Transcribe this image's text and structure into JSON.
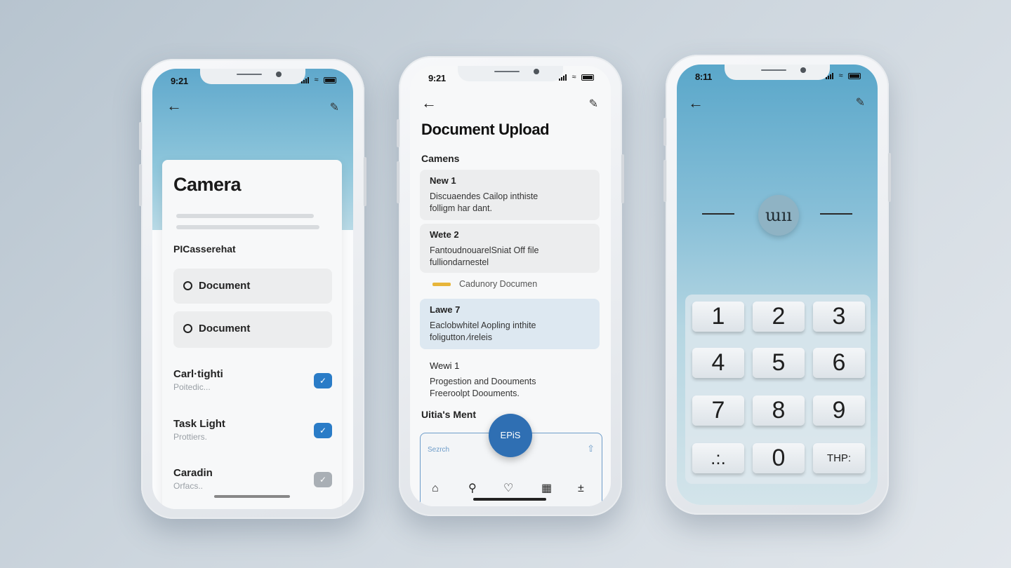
{
  "phones": {
    "camera": {
      "status_time": "9:21",
      "title": "Camera",
      "section": "PICasserehat",
      "options": [
        {
          "label": "Document"
        },
        {
          "label": "Document"
        }
      ],
      "toggles": [
        {
          "title": "Carl·tighti",
          "subtitle": "Poitedic...",
          "checked": true
        },
        {
          "title": "Task Light",
          "subtitle": "Prottiers.",
          "checked": true
        },
        {
          "title": "Caradin",
          "subtitle": "Orfacs..",
          "checked": false
        }
      ],
      "colors": {
        "accent": "#2a7cc7",
        "muted_check": "#a9afb5"
      }
    },
    "upload": {
      "status_time": "9:21",
      "title": "Document Upload",
      "section": "Camens",
      "cards": [
        {
          "title": "New 1",
          "line1": "Dis​cuaendes Cailop inthiste",
          "line2": "folligm har dant."
        },
        {
          "title": "Wete 2",
          "line1": "FantoudnouarelSniat Off file",
          "line2": "fulliondarnestel"
        }
      ],
      "legend_label": "Cadunory Documen",
      "highlight_card": {
        "title": "Lawe 7",
        "line1": "Eaclobwhitel Aopling inthite",
        "line2": "foligutton ∕ireleis"
      },
      "plain_card": {
        "title": "Wewi 1",
        "line1": "Progestion and Doouments",
        "line2": "Freeroolpt Doouments."
      },
      "footer_title": "Uitia's Ment",
      "search_label": "Sezrch",
      "fab_label": "EPiS",
      "colors": {
        "accent": "#2f6fb3",
        "legend": "#e7b53a",
        "highlight": "#dde8f1"
      }
    },
    "keypad": {
      "status_time": "8:11",
      "center_glyph": "ɯıı",
      "keys": [
        "1",
        "2",
        "3",
        "4",
        "5",
        "6",
        "7",
        "8",
        "9",
        ".:.",
        "0",
        "THP:"
      ]
    }
  }
}
